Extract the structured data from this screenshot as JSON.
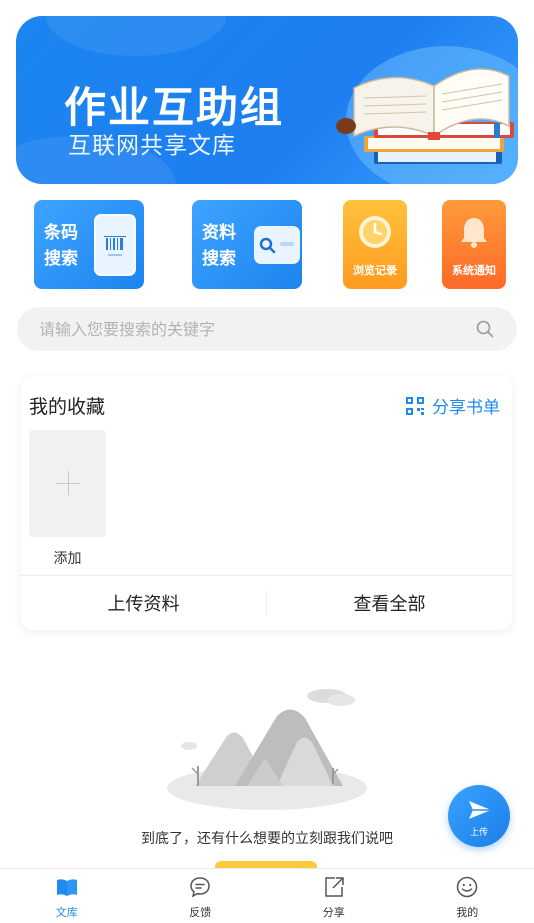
{
  "banner": {
    "title": "作业互助组",
    "subtitle": "互联网共享文库"
  },
  "tiles": [
    {
      "label_line1": "条码",
      "label_line2": "搜索",
      "icon": "barcode-icon"
    },
    {
      "label_line1": "资料",
      "label_line2": "搜索",
      "icon": "search-card-icon"
    },
    {
      "label": "浏览记录",
      "icon": "clock-icon"
    },
    {
      "label": "系统通知",
      "icon": "bell-icon"
    }
  ],
  "search": {
    "placeholder": "请输入您要搜索的关键字"
  },
  "favorites": {
    "title": "我的收藏",
    "share_label": "分享书单",
    "add_label": "添加",
    "upload_label": "上传资料",
    "view_all_label": "查看全部"
  },
  "empty_state": {
    "text": "到底了，还有什么想要的立刻跟我们说吧"
  },
  "fab": {
    "label": "上传"
  },
  "tabbar": {
    "items": [
      {
        "label": "文库",
        "icon": "book-icon",
        "active": true
      },
      {
        "label": "反馈",
        "icon": "feedback-icon",
        "active": false
      },
      {
        "label": "分享",
        "icon": "share-icon",
        "active": false
      },
      {
        "label": "我的",
        "icon": "smile-icon",
        "active": false
      }
    ]
  },
  "colors": {
    "primary": "#1f8af0",
    "orange": "#ff9a1f",
    "red_orange": "#ff6a28",
    "yellow": "#ffc93c"
  }
}
